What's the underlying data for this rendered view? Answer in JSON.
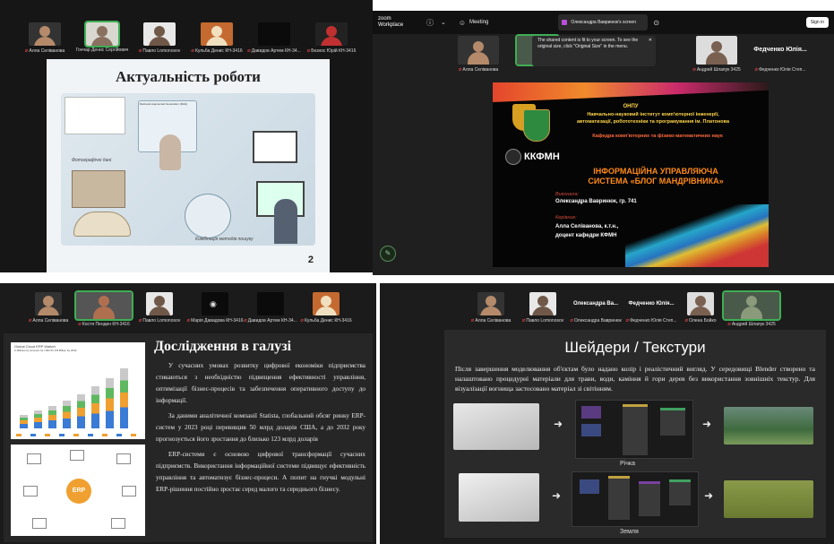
{
  "top_left": {
    "participants": [
      {
        "name": "Алла Селіванова",
        "muted": true
      },
      {
        "name": "Гончар Денис Сергійович",
        "muted": false
      },
      {
        "name": "Павло Lomonosov",
        "muted": true
      },
      {
        "name": "Кульба Денис КН-3416",
        "muted": true
      },
      {
        "name": "Давидов Артем КН-34...",
        "muted": true
      },
      {
        "name": "Безнос Юрій КН-3416",
        "muted": true
      }
    ],
    "slide": {
      "title": "Актуальність роботи",
      "page_number": "2",
      "labels": [
        "Retrieval-Augmented Generation (RAG)",
        "Фотографічні дані",
        "Комбінація методів пошуку"
      ]
    }
  },
  "top_right": {
    "app_name": "zoom Workplace",
    "tab_label": "Meeting",
    "share_label": "Олександра Вавринюк's screen",
    "signin_label": "Sign in",
    "tooltip": "The shared content is fit to your screen. To see the original size, click \"Original Size\" in the menu.",
    "participants": [
      {
        "name": "Алла Селіванова",
        "muted": true
      },
      {
        "name": "",
        "muted": false
      },
      {
        "name": "Андрей Шлапук 3425",
        "muted": true
      },
      {
        "name": "Федченко Юлія Степ...",
        "muted": true
      }
    ],
    "speaker_name": "Федченко Юлія...",
    "slide": {
      "org": "ОНПУ",
      "institute": "Навчально-науковий інститут комп'ютерної інженерії, автоматизації, робототехніки та програмування ім. Платонова",
      "department": "Кафедра комп'ютерних та фізико-математичних наук",
      "logo_text": "ККФМН",
      "title_line1": "ІНФОРМАЦІЙНА УПРАВЛЯЮЧА",
      "title_line2": "СИСТЕМА «БЛОГ МАНДРІВНИКА»",
      "executor_label": "Виконала:",
      "executor_name": "Олександра Вавринюк, гр. 741",
      "supervisor_label": "Керівник:",
      "supervisor_name": "Алла Селіванова, к.т.н.,",
      "supervisor_title": "доцент кафедри КФМН"
    }
  },
  "bottom_left": {
    "participants": [
      {
        "name": "Алла Селіванова",
        "muted": true
      },
      {
        "name": "Костя Пенден КН-3416",
        "muted": true
      },
      {
        "name": "Павло Lomonosov",
        "muted": true
      },
      {
        "name": "Марія Давидова КН-3416",
        "muted": true
      },
      {
        "name": "Давидов Артем КН-34...",
        "muted": true
      },
      {
        "name": "Кульба Денис КН-3416",
        "muted": true
      }
    ],
    "slide": {
      "title": "Дослідження в галузі",
      "chart_title": "Global Cloud ERP Market",
      "chart_subtitle": "in Billions by Account for USD 51.6 B Billion by 2032",
      "erp_label": "ERP",
      "paragraphs": [
        "У сучасних умовах розвитку цифрової економіки підприємства стикаються з необхідністю підвищення ефективності управління, оптимізації бізнес-процесів та забезпечення оперативного доступу до інформації.",
        "За даними аналітичної компанії Statista, глобальний обсяг ринку ERP-систем у 2023 році перевищив 50 млрд доларів США, а до 2032 року прогнозується його зростання до близько 123 млрд доларів",
        "ERP-системи є основою цифрової трансформації сучасних підприємств. Використання інформаційної системи підвищує ефективність управління та автоматизує бізнес-процеси. А попит на гнучкі модульні ERP-рішення постійно зростає серед малого та середнього бізнесу."
      ]
    }
  },
  "bottom_right": {
    "participants": [
      {
        "name": "Алла Селіванова",
        "muted": true
      },
      {
        "name": "Павло Lomonosov",
        "muted": true
      },
      {
        "name": "Олександра Вавринюк",
        "muted": true
      },
      {
        "name": "Федченко Юлія Степ...",
        "muted": true
      },
      {
        "name": "Олена Бойко",
        "muted": true
      },
      {
        "name": "Андрей Шлапук 3425",
        "muted": true
      }
    ],
    "header_names": [
      "Олександра Ва...",
      "Федченко Юлія..."
    ],
    "slide": {
      "title": "Шейдери / Текстури",
      "text": "Після завершення моделювання об'єктам було надано колір і реалістичний вигляд. У середовищі Blender створено та налаштовано процедурні матеріали для трави, води, каміння й гори дерев без використання зовнішніх текстур. Для візуалізації вогнища застосовано матеріал зі світінням.",
      "caption1": "Річка",
      "caption2": "Земля"
    }
  }
}
